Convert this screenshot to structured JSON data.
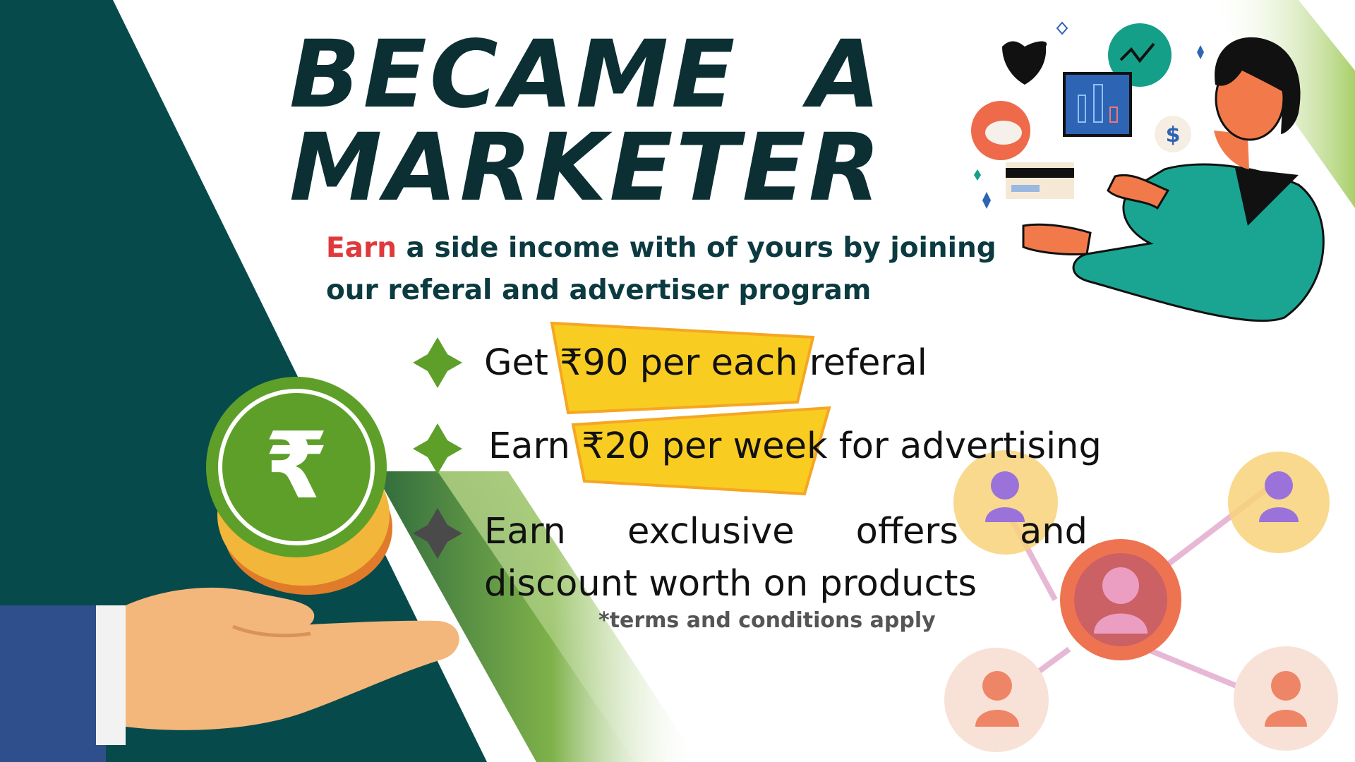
{
  "title": {
    "line1": "BECAME  A",
    "line2": "MARKETER"
  },
  "subtitle": {
    "accent": "Earn",
    "rest": " a side income with of yours by joining our referal and advertiser program"
  },
  "bullets": [
    {
      "text": "Get  ₹90 per each referal",
      "icon": "green-sparkle-icon"
    },
    {
      "text": "Earn ₹20 per week for advertising",
      "icon": "green-sparkle-icon"
    },
    {
      "text": "Earn exclusive offers and discount worth on products",
      "icon": "gray-sparkle-icon"
    }
  ],
  "terms": "*terms and conditions apply",
  "coin_symbol": "₹",
  "icons": [
    "rupee-coin-icon",
    "hand-icon",
    "shield-icon",
    "chart-icon",
    "piggy-bank-icon",
    "credit-card-icon",
    "dollar-icon",
    "network-people-icon"
  ],
  "colors": {
    "dark_teal": "#064a4c",
    "title": "#0b2f33",
    "accent_red": "#e0393c",
    "highlight_yellow": "#f9cc22",
    "green": "#5e9f2a",
    "light_green": "#b5d87a"
  }
}
